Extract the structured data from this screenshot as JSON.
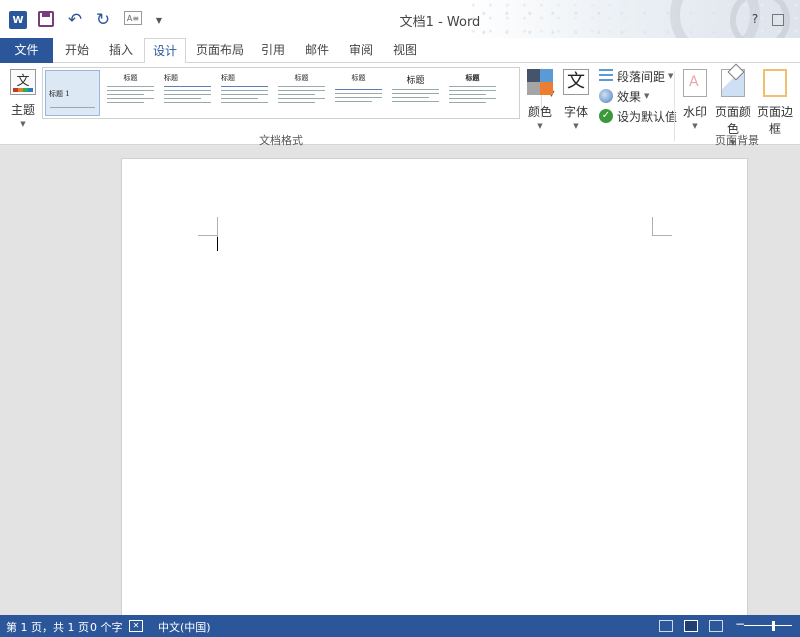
{
  "window": {
    "title": "文档1 - Word",
    "help": "?"
  },
  "quick_access": {
    "word_logo": "W",
    "touch_mode": "A≡"
  },
  "tabs": [
    {
      "label": "文件"
    },
    {
      "label": "开始"
    },
    {
      "label": "插入"
    },
    {
      "label": "设计"
    },
    {
      "label": "页面布局"
    },
    {
      "label": "引用"
    },
    {
      "label": "邮件"
    },
    {
      "label": "审阅"
    },
    {
      "label": "视图"
    }
  ],
  "active_tab": "设计",
  "ribbon": {
    "theme": {
      "label": "主题",
      "glyph": "文"
    },
    "document_formatting": {
      "group_label": "文档格式",
      "styles": [
        {
          "title": "标题 1"
        },
        {
          "title": "标题"
        },
        {
          "title": "标题"
        },
        {
          "title": "标题"
        },
        {
          "title": "标题"
        },
        {
          "title": "标题"
        },
        {
          "title": "标题"
        },
        {
          "title": "标题"
        }
      ]
    },
    "colors": {
      "label": "颜色"
    },
    "fonts": {
      "label": "字体",
      "glyph": "文"
    },
    "paragraph_spacing": {
      "label": "段落间距"
    },
    "effects": {
      "label": "效果"
    },
    "set_default": {
      "label": "设为默认值"
    },
    "page_background": {
      "group_label": "页面背景",
      "watermark": {
        "label": "水印"
      },
      "page_color": {
        "label": "页面颜色"
      },
      "page_borders": {
        "label": "页面边框"
      }
    }
  },
  "status_bar": {
    "page": "第 1 页，共 1 页",
    "words": "0 个字",
    "language": "中文(中国)",
    "zoom_minus": "−"
  },
  "colors": {
    "accent": "#2b579a"
  }
}
